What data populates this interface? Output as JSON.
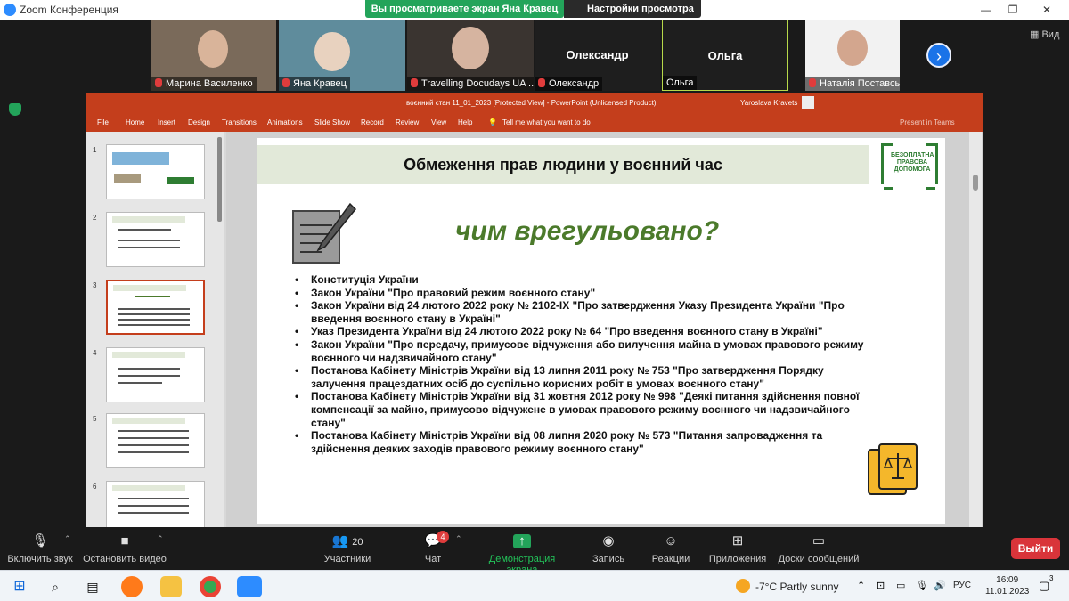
{
  "zoom": {
    "window_title": "Zoom Конференция",
    "share_banner": "Вы просматриваете экран Яна Кравец",
    "view_options": "Настройки просмотра",
    "view_toggle": "Вид",
    "participants": [
      {
        "name": "Марина Василенко",
        "muted": true
      },
      {
        "name": "Яна Кравец",
        "muted": true
      },
      {
        "name": "Travelling Docudays UA ...",
        "muted": true
      },
      {
        "name": "Олександр",
        "muted": true,
        "display": "Олександр"
      },
      {
        "name": "Ольга",
        "muted": false,
        "display": "Ольга"
      },
      {
        "name": "Наталія Поставська",
        "muted": true
      }
    ]
  },
  "ppt": {
    "title": "воєнний стан 11_01_2023 [Protected View] - PowerPoint (Unlicensed Product)",
    "user": "Yaroslava Kravets",
    "present_teams": "Present in Teams",
    "menu": [
      "File",
      "Home",
      "Insert",
      "Design",
      "Transitions",
      "Animations",
      "Slide Show",
      "Record",
      "Review",
      "View",
      "Help"
    ],
    "tell_me": "Tell me what you want to do",
    "slide_numbers": [
      "1",
      "2",
      "3",
      "4",
      "5",
      "6"
    ],
    "slide": {
      "title": "Обмеження прав людини у воєнний час",
      "logo_text": "БЕЗОПЛАТНА ПРАВОВА ДОПОМОГА",
      "subtitle": "чим врегульовано?",
      "sources": [
        "Конституція України",
        "Закон України \"Про правовий режим воєнного стану\"",
        "Закон України від 24 лютого 2022 року № 2102-IX \"Про затвердження Указу Президента України \"Про введення воєнного стану в Україні\"",
        "Указ Президента України від 24 лютого 2022 року № 64 \"Про введення воєнного стану в Україні\"",
        "Закон України \"Про передачу, примусове відчуження або вилучення майна в умовах правового режиму воєнного чи надзвичайного стану\"",
        "Постанова Кабінету Міністрів України від 13 липня 2011 року № 753 \"Про затвердження Порядку залучення працездатних осіб до суспільно корисних робіт в умовах воєнного стану\"",
        "Постанова Кабінету Міністрів України від 31 жовтня 2012 року № 998 \"Деякі питання здійснення повної компенсації за майно, примусово відчужене в умовах правового режиму воєнного чи надзвичайного стану\"",
        "Постанова Кабінету Міністрів України від 08 липня 2020 року № 573 \"Питання запровадження та здійснення деяких заходів правового режиму воєнного стану\""
      ]
    }
  },
  "toolbar": {
    "unmute": "Включить звук",
    "video": "Остановить видео",
    "participants": "Участники",
    "participants_count": "20",
    "chat": "Чат",
    "chat_badge": "4",
    "share": "Демонстрация экрана",
    "record": "Запись",
    "reactions": "Реакции",
    "apps": "Приложения",
    "whiteboard": "Доски сообщений",
    "leave": "Выйти"
  },
  "taskbar": {
    "weather": "-7°C  Partly sunny",
    "lang": "РУС",
    "time": "16:09",
    "date": "11.01.2023",
    "notifications": "3"
  },
  "colors": {
    "ppt_red": "#c43e1c",
    "share_green": "#23a45a",
    "leave_red": "#d9343a",
    "subtitle_green": "#4b7a2b"
  }
}
